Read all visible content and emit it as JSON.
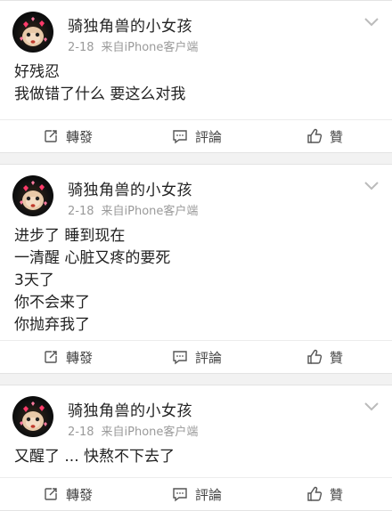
{
  "posts": [
    {
      "author": "骑独角兽的小女孩",
      "date": "2-18",
      "source": "来自iPhone客户端",
      "lines": [
        "好残忍",
        "我做错了什么 要这么对我"
      ],
      "actions": {
        "repost": "轉發",
        "comment": "評論",
        "like": "贊"
      }
    },
    {
      "author": "骑独角兽的小女孩",
      "date": "2-18",
      "source": "来自iPhone客户端",
      "lines": [
        "进步了 睡到现在",
        "一清醒 心脏又疼的要死",
        "3天了",
        "你不会来了",
        "你抛弃我了"
      ],
      "actions": {
        "repost": "轉發",
        "comment": "評論",
        "like": "贊"
      }
    },
    {
      "author": "骑独角兽的小女孩",
      "date": "2-18",
      "source": "来自iPhone客户端",
      "lines": [
        "又醒了 ... 快熬不下去了"
      ],
      "actions": {
        "repost": "轉發",
        "comment": "評論",
        "like": "贊"
      }
    }
  ],
  "icons": {
    "avatar": "cartoon-avatar-with-hearts",
    "menu": "chevron-down-icon",
    "repost": "repost-icon",
    "comment": "comment-icon",
    "like": "thumbs-up-icon"
  },
  "colors": {
    "background": "#f2f2f2",
    "card": "#ffffff",
    "text": "#222222",
    "meta": "#9a9a9a",
    "heart": "#ff3b6b"
  }
}
